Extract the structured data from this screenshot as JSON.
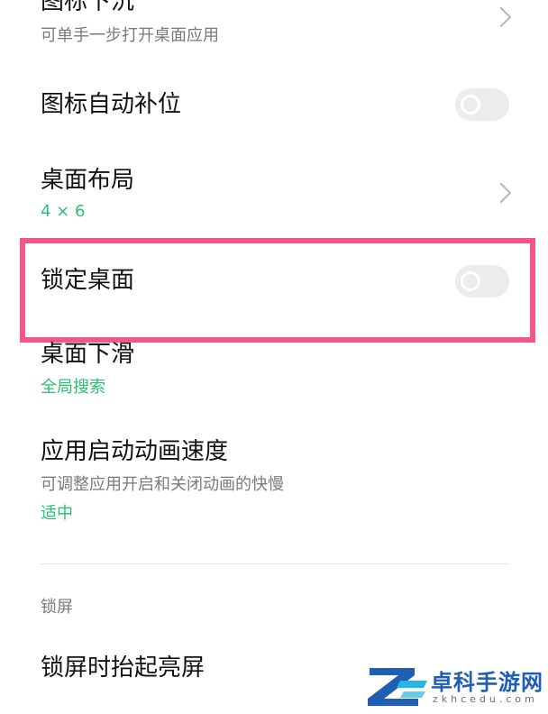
{
  "settings": {
    "icon_sink": {
      "title": "图标下沉",
      "subtitle": "可单手一步打开桌面应用"
    },
    "icon_auto_fill": {
      "title": "图标自动补位",
      "enabled": false
    },
    "desktop_layout": {
      "title": "桌面布局",
      "value": "4 × 6"
    },
    "lock_desktop": {
      "title": "锁定桌面",
      "enabled": false
    },
    "desktop_swipe_down": {
      "title": "桌面下滑",
      "value": "全局搜索"
    },
    "app_launch_animation_speed": {
      "title": "应用启动动画速度",
      "subtitle": "可调整应用开启和关闭动画的快慢",
      "value": "适中"
    }
  },
  "lock_screen_section": {
    "label": "锁屏",
    "raise_to_wake": {
      "title": "锁屏时抬起亮屏"
    }
  },
  "watermark": {
    "brand": "卓科手游网",
    "domain": "zkhcedu.com"
  },
  "colors": {
    "accent_green": "#2bbf73",
    "highlight_pink": "#f2578c",
    "watermark_blue": "#1e5fb4"
  }
}
